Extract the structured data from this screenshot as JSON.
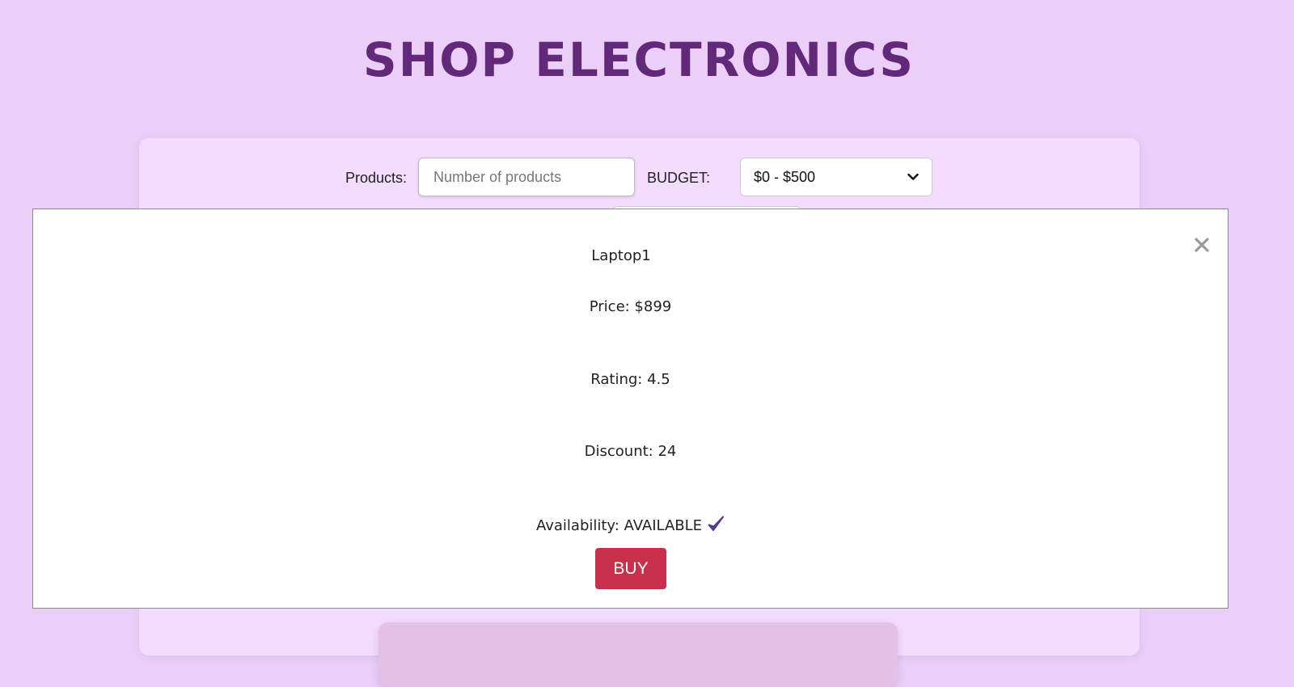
{
  "header": {
    "title": "SHOP ELECTRONICS"
  },
  "filters": {
    "products_label": "Products:",
    "products_placeholder": "Number of products",
    "budget_label": "BUDGET:",
    "budget_selected": "$0 - $500"
  },
  "modal": {
    "product_name": "Laptop1",
    "price": "Price: $899",
    "rating": "Rating: 4.5",
    "discount": "Discount: 24",
    "availability": "Availability: AVAILABLE",
    "buy_label": "BUY",
    "close_symbol": "×"
  },
  "icons": {
    "close": "close-icon",
    "availability": "check-icon",
    "select": "chevron-down-icon"
  },
  "colors": {
    "background": "#ebcff8",
    "panel": "#f4dcff",
    "title": "#62297a",
    "buy_button": "#c8304c",
    "check": "#5a3a8c"
  }
}
